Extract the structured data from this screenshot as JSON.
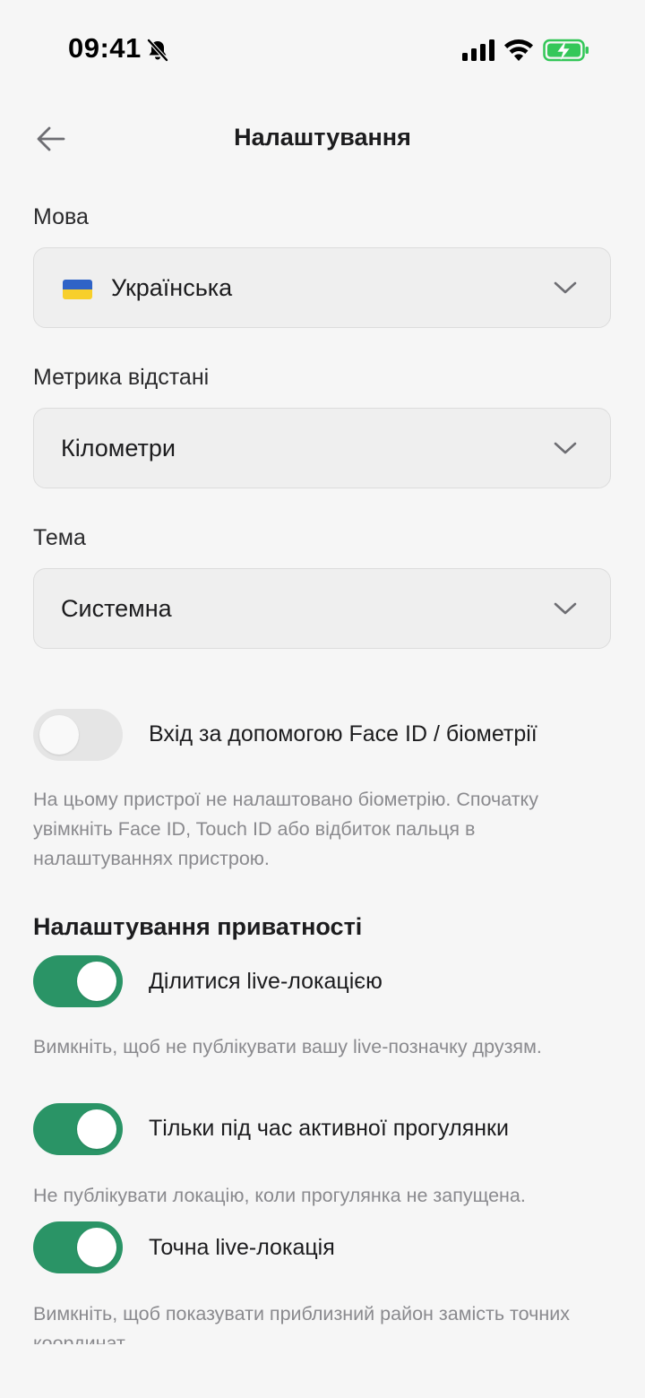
{
  "status_bar": {
    "time": "09:41",
    "icons": [
      "bell-slash-icon",
      "cellular-signal-icon",
      "wifi-icon",
      "battery-charging-icon"
    ],
    "battery_color": "#34c759"
  },
  "header": {
    "title": "Налаштування",
    "back_icon": "arrow-left-icon"
  },
  "language": {
    "label": "Мова",
    "value": "Українська",
    "flag": "ukraine-flag-icon"
  },
  "distance": {
    "label": "Метрика відстані",
    "value": "Кілометри"
  },
  "theme": {
    "label": "Тема",
    "value": "Системна"
  },
  "biometrics": {
    "label": "Вхід за допомогою Face ID / біометрії",
    "enabled": false,
    "help": "На цьому пристрої не налаштовано біометрію. Спочатку увімкніть Face ID, Touch ID або відбиток пальця в налаштуваннях пристрою."
  },
  "privacy": {
    "title": "Налаштування приватності",
    "items": [
      {
        "label": "Ділитися live-локацією",
        "enabled": true,
        "help": "Вимкніть, щоб не публікувати вашу live-позначку друзям."
      },
      {
        "label": "Тільки під час активної прогулянки",
        "enabled": true,
        "help": "Не публікувати локацію, коли прогулянка не запущена."
      },
      {
        "label": "Точна live-локація",
        "enabled": true,
        "help": "Вимкніть, щоб показувати приблизний район замість точних координат."
      }
    ]
  },
  "colors": {
    "accent": "#2a9466",
    "background": "#f6f6f6",
    "field_background": "#efefef",
    "help_text": "#8a8a8e"
  }
}
